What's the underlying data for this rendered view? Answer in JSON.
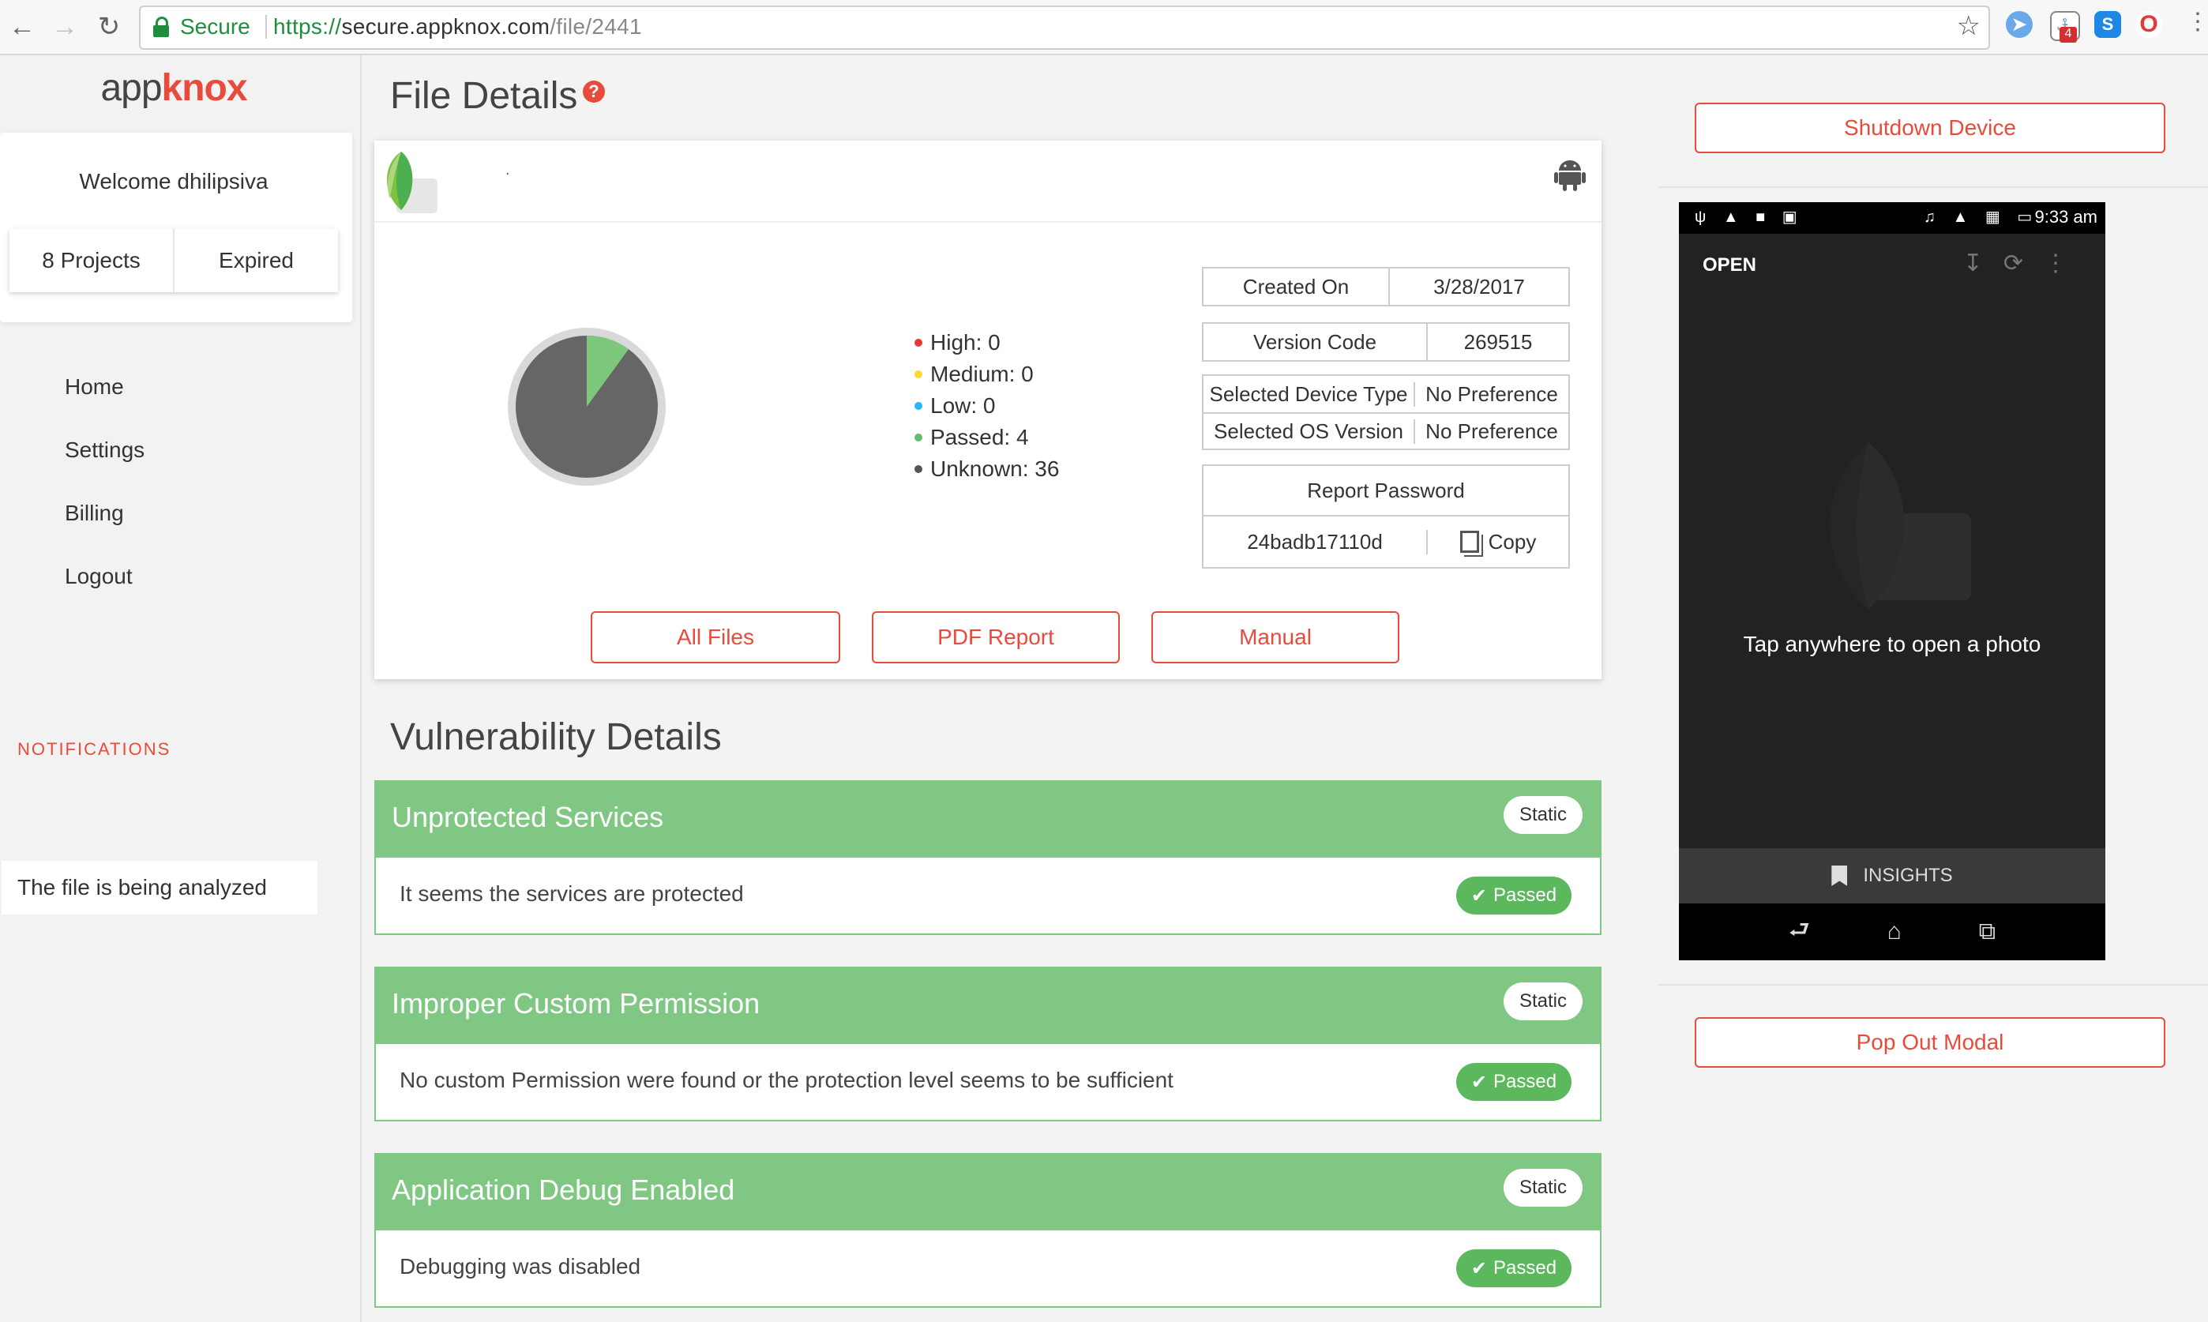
{
  "browser": {
    "secure_label": "Secure",
    "url_scheme": "https://",
    "url_host": "secure.appknox.com",
    "url_path": "/file/2441",
    "ext_badge_count": "4"
  },
  "sidebar": {
    "logo_app": "app",
    "logo_knox": "knox",
    "welcome": "Welcome dhilipsiva",
    "projects": "8 Projects",
    "status": "Expired",
    "nav": [
      "Home",
      "Settings",
      "Billing",
      "Logout"
    ],
    "notifications_title": "NOTIFICATIONS",
    "notification": "The file is being analyzed"
  },
  "main": {
    "page_title": "File Details",
    "help": "?",
    "app_name_placeholder": ".",
    "legend": [
      {
        "label": "High: 0",
        "color": "#e53935"
      },
      {
        "label": "Medium: 0",
        "color": "#fdd835"
      },
      {
        "label": "Low: 0",
        "color": "#29b6f6"
      },
      {
        "label": "Passed: 4",
        "color": "#66bb6a"
      },
      {
        "label": "Unknown: 36",
        "color": "#555555"
      }
    ],
    "chart": {
      "passed": 4,
      "unknown": 36,
      "high": 0,
      "medium": 0,
      "low": 0
    },
    "info": {
      "created_on_label": "Created On",
      "created_on_value": "3/28/2017",
      "version_code_label": "Version Code",
      "version_code_value": "269515",
      "device_type_label": "Selected Device Type",
      "device_type_value": "No Preference",
      "os_version_label": "Selected OS Version",
      "os_version_value": "No Preference",
      "report_password_label": "Report Password",
      "report_password_value": "24badb17110d",
      "copy_label": "Copy"
    },
    "buttons": {
      "all_files": "All Files",
      "pdf_report": "PDF Report",
      "manual": "Manual"
    },
    "vuln_title": "Vulnerability Details",
    "vulnerabilities": [
      {
        "title": "Unprotected Services",
        "type": "Static",
        "desc": "It seems the services are protected",
        "status": "Passed"
      },
      {
        "title": "Improper Custom Permission",
        "type": "Static",
        "desc": "No custom Permission were found or the protection level seems to be sufficient",
        "status": "Passed"
      },
      {
        "title": "Application Debug Enabled",
        "type": "Static",
        "desc": "Debugging was disabled",
        "status": "Passed"
      }
    ]
  },
  "right": {
    "shutdown": "Shutdown Device",
    "popout": "Pop Out Modal",
    "device": {
      "time": "9:33 am",
      "open": "OPEN",
      "tap_text": "Tap anywhere to open a photo",
      "insights": "INSIGHTS"
    }
  },
  "colors": {
    "accent": "#e84b3c",
    "green": "#81c784",
    "passed": "#5cb85c"
  }
}
